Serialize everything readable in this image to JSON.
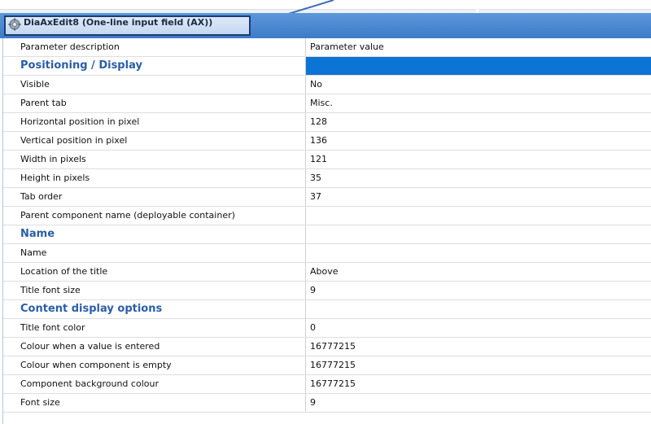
{
  "window": {
    "title": "DiaAxEdit8 (One-line input field (AX))",
    "accent_color": "#3c7bc8",
    "highlight_color": "#0c74d4",
    "section_color": "#2a5ea8",
    "icon": "gear-icon"
  },
  "grid": {
    "columns": [
      "Parameter description",
      "Parameter value"
    ],
    "rows": [
      {
        "type": "section",
        "label": "Positioning / Display",
        "value": "",
        "selected": true
      },
      {
        "type": "row",
        "label": "Visible",
        "value": "No"
      },
      {
        "type": "row",
        "label": "Parent tab",
        "value": "Misc."
      },
      {
        "type": "row",
        "label": "Horizontal position in pixel",
        "value": "128"
      },
      {
        "type": "row",
        "label": "Vertical position in pixel",
        "value": "136"
      },
      {
        "type": "row",
        "label": "Width in pixels",
        "value": "121"
      },
      {
        "type": "row",
        "label": "Height in pixels",
        "value": "35"
      },
      {
        "type": "row",
        "label": "Tab order",
        "value": "37"
      },
      {
        "type": "row",
        "label": "Parent component name (deployable container)",
        "value": ""
      },
      {
        "type": "section",
        "label": "Name",
        "value": ""
      },
      {
        "type": "row",
        "label": "Name",
        "value": ""
      },
      {
        "type": "row",
        "label": "Location of the title",
        "value": "Above"
      },
      {
        "type": "row",
        "label": "Title font size",
        "value": "9"
      },
      {
        "type": "section",
        "label": "Content display options",
        "value": ""
      },
      {
        "type": "row",
        "label": "Title font color",
        "value": "0"
      },
      {
        "type": "row",
        "label": "Colour when a value is entered",
        "value": "16777215"
      },
      {
        "type": "row",
        "label": "Colour when component is empty",
        "value": "16777215"
      },
      {
        "type": "row",
        "label": "Component background colour",
        "value": "16777215"
      },
      {
        "type": "row",
        "label": "Font size",
        "value": "9"
      }
    ]
  }
}
